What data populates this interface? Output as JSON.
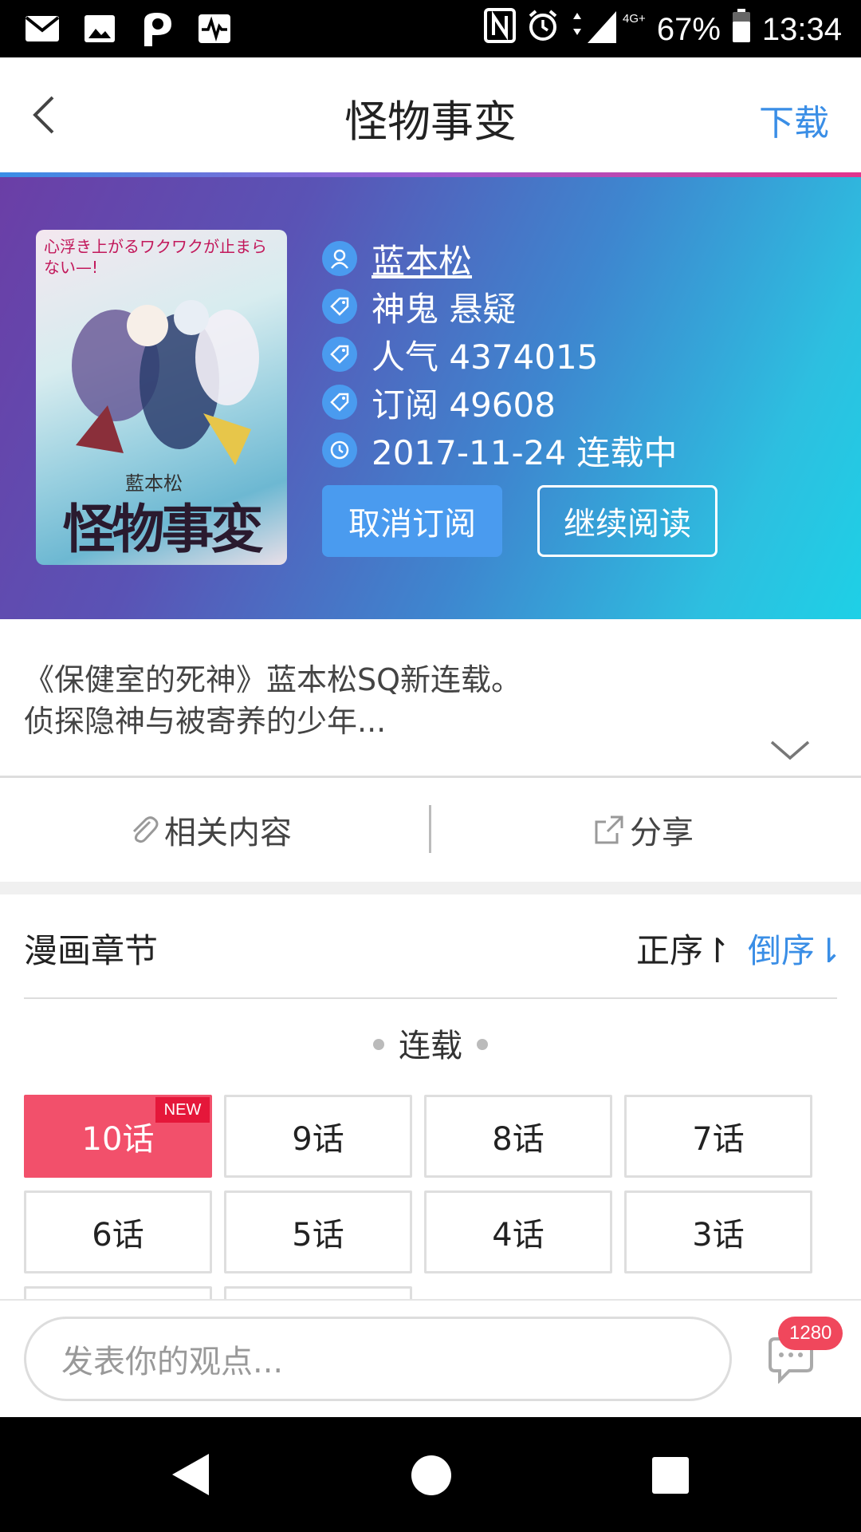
{
  "status_bar": {
    "battery": "67%",
    "time": "13:34",
    "network": "4G+",
    "left_icons": [
      "mail-icon",
      "image-icon",
      "p-app-icon",
      "pulse-icon"
    ],
    "right_icons": [
      "nfc-icon",
      "alarm-icon",
      "signal-icon",
      "battery-icon"
    ]
  },
  "header": {
    "title": "怪物事变",
    "download_label": "下载"
  },
  "comic": {
    "cover": {
      "top_text": "心浮き上がるワクワクが止まらない—!",
      "author": "藍本松",
      "title": "怪物事変"
    },
    "author": "蓝本松",
    "tags": "神鬼 悬疑",
    "popularity": "人气 4374015",
    "subscriptions": "订阅 49608",
    "update": "2017-11-24 连载中",
    "unsubscribe_label": "取消订阅",
    "continue_label": "继续阅读"
  },
  "description": {
    "line1": "《保健室的死神》蓝本松SQ新连载。",
    "line2": "侦探隐神与被寄养的少年..."
  },
  "actions": {
    "related_label": "相关内容",
    "share_label": "分享"
  },
  "chapters": {
    "title": "漫画章节",
    "sort_asc": "正序↾",
    "sort_desc": "倒序⇂",
    "section": "连载",
    "new_badge": "NEW",
    "items": [
      "10话",
      "9话",
      "8话",
      "7话",
      "6话",
      "5话",
      "4话",
      "3话"
    ]
  },
  "comment": {
    "placeholder": "发表你的观点...",
    "count": "1280"
  },
  "colors": {
    "accent": "#3a8ee6",
    "active_chapter": "#f2506b",
    "badge": "#f0475c"
  }
}
